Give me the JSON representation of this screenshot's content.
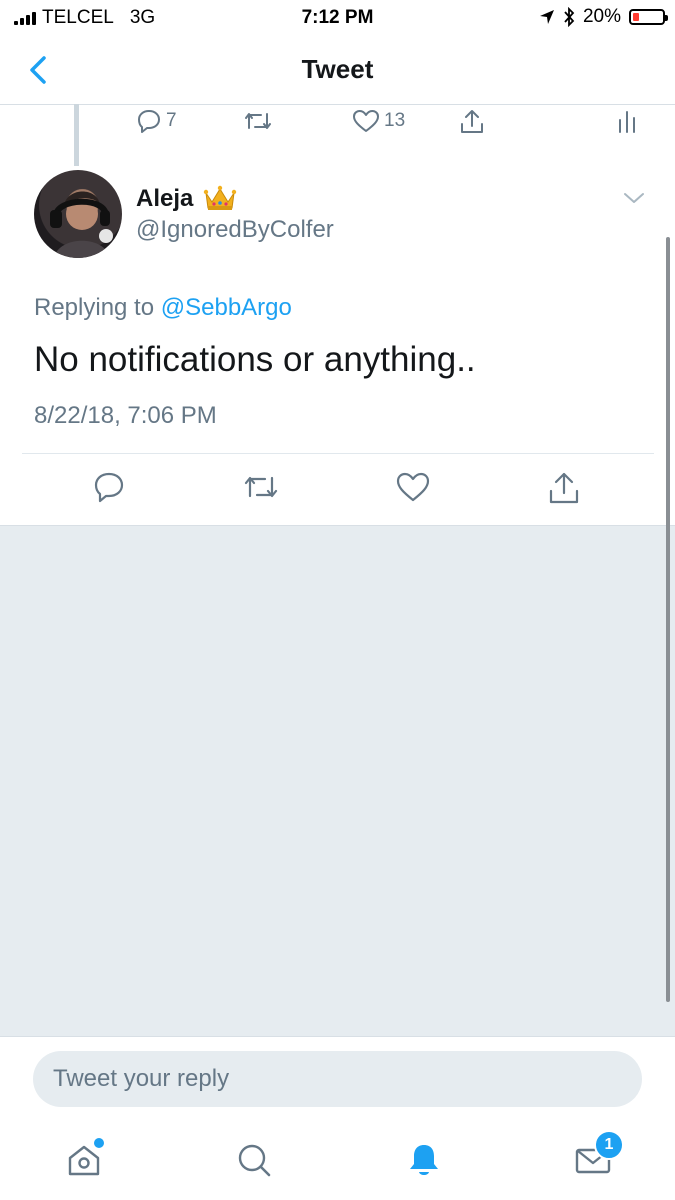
{
  "status_bar": {
    "carrier": "TELCEL",
    "network": "3G",
    "time": "7:12 PM",
    "battery_percent": "20%",
    "battery_level": 0.2,
    "icons": [
      "signal-icon",
      "location-arrow-icon",
      "bluetooth-icon",
      "battery-icon"
    ]
  },
  "nav": {
    "title": "Tweet",
    "back_icon": "chevron-left-icon"
  },
  "parent_tweet_actions": {
    "reply_count": "7",
    "retweet_count": "",
    "like_count": "13"
  },
  "tweet": {
    "display_name": "Aleja",
    "name_emoji": "crown-emoji",
    "username": "@IgnoredByColfer",
    "reply_prefix": "Replying to",
    "reply_handle": "@SebbArgo",
    "text": "No notifications or anything..",
    "timestamp": "8/22/18, 7:06 PM"
  },
  "composer": {
    "placeholder": "Tweet your reply"
  },
  "tab_bar": {
    "tabs": [
      "home-icon",
      "search-icon",
      "notifications-icon",
      "messages-icon"
    ],
    "active_tab": "notifications",
    "messages_badge": "1"
  },
  "colors": {
    "accent": "#1da1f2",
    "secondary_text": "#657786",
    "background_gray": "#e6ecf0",
    "battery_low": "#ff3b30"
  }
}
